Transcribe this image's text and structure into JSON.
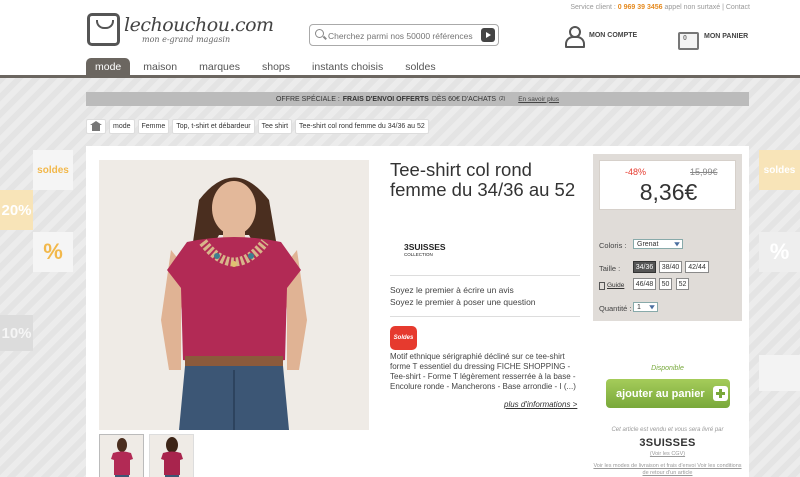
{
  "header": {
    "service_client_label": "Service client :",
    "phone": "0 969 39 3456",
    "phone_note": "appel non surtaxé | Contact",
    "logo_name": "lechouchou.com",
    "logo_tagline": "mon e-grand magasin",
    "search_placeholder": "Cherchez parmi nos 50000 références",
    "account_label": "MON COMPTE",
    "cart_label": "MON PANIER",
    "cart_count": "0"
  },
  "nav": {
    "items": [
      "mode",
      "maison",
      "marques",
      "shops",
      "instants choisis",
      "soldes"
    ],
    "active": "mode"
  },
  "promo": {
    "prefix": "OFFRE SPÉCIALE :",
    "highlight": "FRAIS D'ENVOI OFFERTS",
    "suffix": "DÈS 60€ D'ACHATS",
    "superscript": "(2)",
    "link": "En savoir plus"
  },
  "breadcrumb": [
    "mode",
    "Femme",
    "Top, t-shirt et débardeur",
    "Tee shirt",
    "Tee-shirt col rond femme du 34/36 au 52"
  ],
  "decorations": {
    "soldes_left": "soldes",
    "twenty": "20%",
    "percent_left": "%",
    "ten": "10%",
    "soldes_right": "soldes",
    "percent_right": "%"
  },
  "product": {
    "title": "Tee-shirt col rond femme du 34/36 au 52",
    "brand_line1": "3SUISSES",
    "brand_line2": "COLLECTION",
    "review_write": "Soyez le premier à écrire un avis",
    "review_ask": "Soyez le premier à poser une question",
    "soldes_badge": "Soldes",
    "description": "Motif ethnique sérigraphié décliné sur ce tee-shirt forme T essentiel du dressing FICHE SHOPPING - Tee-shirt - Forme T légèrement resserrée à la base - Encolure ronde - Mancherons - Base arrondie - I (...)",
    "more_info": "plus d'informations >"
  },
  "buybox": {
    "discount": "-48%",
    "old_price": "15,99€",
    "new_price": "8,36€",
    "colors_label": "Coloris :",
    "color_selected": "Grenat",
    "size_label": "Taille :",
    "guide_label": "Guide",
    "sizes": [
      "34/36",
      "38/40",
      "42/44",
      "46/48",
      "50",
      "52"
    ],
    "size_selected": "34/36",
    "quantity_label": "Quantité :",
    "quantity_selected": "1",
    "availability": "Disponible",
    "add_to_cart": "ajouter au panier",
    "sold_by_text": "Cet article est vendu et vous sera livré par",
    "seller_name": "3SUISSES",
    "cgv_link": "(Voir les CGV)",
    "modes_link": "Voir les modes de livraison et frais d'envoi Voir les conditions de retour d'un article"
  },
  "colors": {
    "accent_dark": "#6b6660",
    "discount_red": "#e63a2e",
    "add_button_green": "#79a83a",
    "shirt": "#b22a55"
  }
}
